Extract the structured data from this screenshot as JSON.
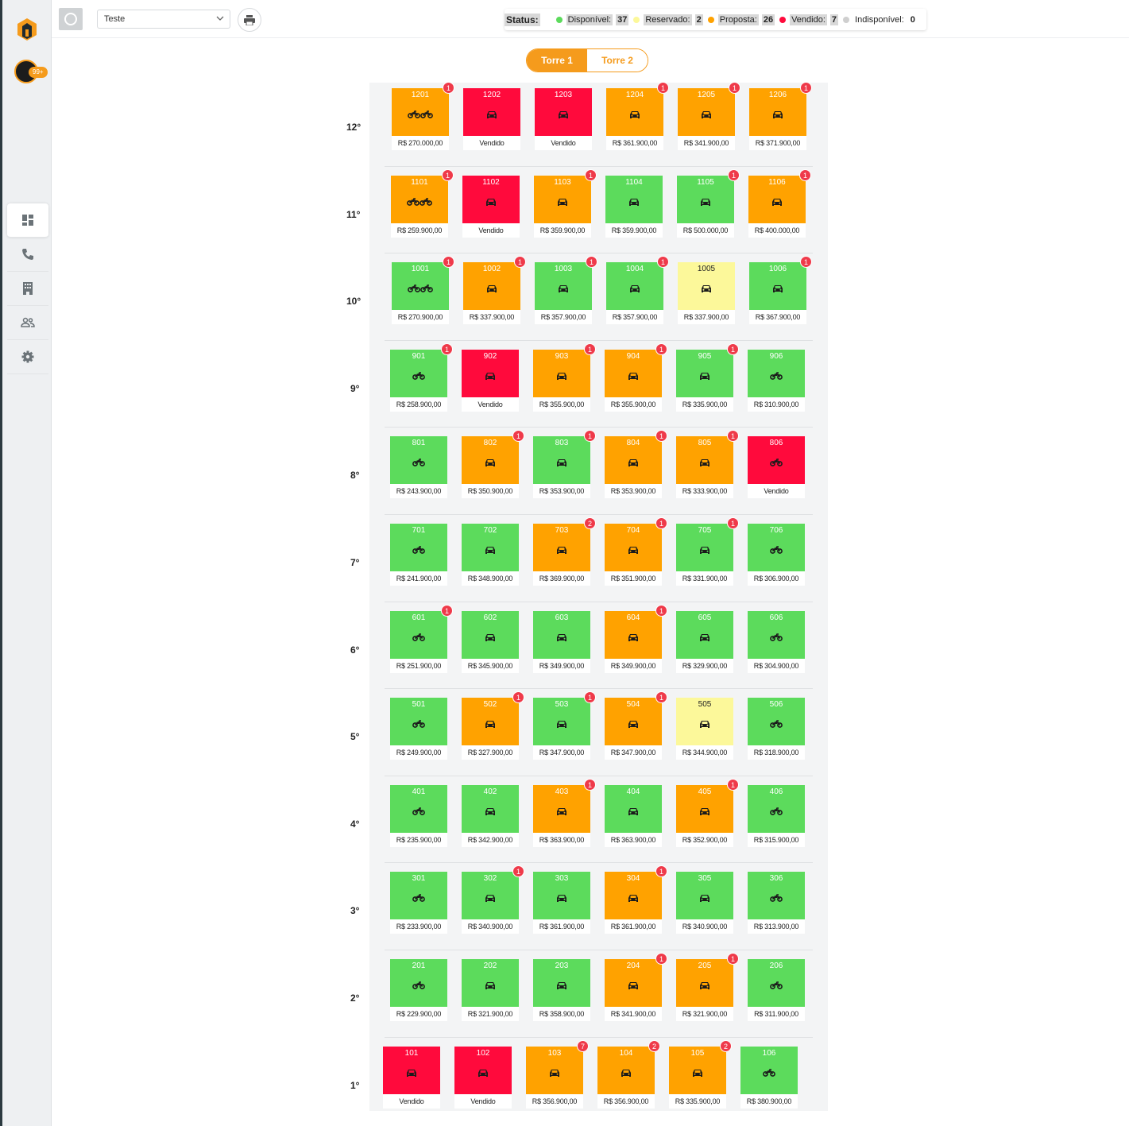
{
  "colors": {
    "disponivel": "#5cdb5c",
    "reservado": "#fcf89a",
    "proposta": "#ffa200",
    "vendido": "#ff0a3c",
    "indisponivel": "#cfcfcf",
    "accent": "#f59b1c"
  },
  "sidebar": {
    "notif_count": "99+",
    "nav": [
      {
        "icon": "dashboard-icon",
        "active": true
      },
      {
        "icon": "phone-icon",
        "active": false
      },
      {
        "icon": "building-icon",
        "active": false
      },
      {
        "icon": "people-icon",
        "active": false
      },
      {
        "icon": "gear-icon",
        "active": false
      }
    ]
  },
  "header": {
    "select_value": "Teste",
    "status_title": "Status:",
    "status": [
      {
        "label": "Disponível:",
        "count": "37",
        "color": "#5cdb5c"
      },
      {
        "label": "Reservado:",
        "count": "2",
        "color": "#fcf89a"
      },
      {
        "label": "Proposta:",
        "count": "26",
        "color": "#ffa200"
      },
      {
        "label": "Vendido:",
        "count": "7",
        "color": "#ff0a3c"
      },
      {
        "label": "Indisponível:",
        "count": "0",
        "color": "#cfcfcf"
      }
    ]
  },
  "tabs": [
    {
      "label": "Torre 1",
      "active": true
    },
    {
      "label": "Torre 2",
      "active": false
    }
  ],
  "floors": [
    {
      "label": "12°",
      "units": [
        {
          "num": "1201",
          "status": "proposta",
          "price": "R$ 270.000,00",
          "badge": "1",
          "vehicle": "moto2"
        },
        {
          "num": "1202",
          "status": "vendido",
          "price": "Vendido",
          "badge": "",
          "vehicle": "car"
        },
        {
          "num": "1203",
          "status": "vendido",
          "price": "Vendido",
          "badge": "",
          "vehicle": "car"
        },
        {
          "num": "1204",
          "status": "proposta",
          "price": "R$ 361.900,00",
          "badge": "1",
          "vehicle": "car"
        },
        {
          "num": "1205",
          "status": "proposta",
          "price": "R$ 341.900,00",
          "badge": "1",
          "vehicle": "car"
        },
        {
          "num": "1206",
          "status": "proposta",
          "price": "R$ 371.900,00",
          "badge": "1",
          "vehicle": "car"
        }
      ]
    },
    {
      "label": "11°",
      "units": [
        {
          "num": "1101",
          "status": "proposta",
          "price": "R$ 259.900,00",
          "badge": "1",
          "vehicle": "moto2"
        },
        {
          "num": "1102",
          "status": "vendido",
          "price": "Vendido",
          "badge": "",
          "vehicle": "car"
        },
        {
          "num": "1103",
          "status": "proposta",
          "price": "R$ 359.900,00",
          "badge": "1",
          "vehicle": "car"
        },
        {
          "num": "1104",
          "status": "disponivel",
          "price": "R$ 359.900,00",
          "badge": "",
          "vehicle": "car"
        },
        {
          "num": "1105",
          "status": "disponivel",
          "price": "R$ 500.000,00",
          "badge": "1",
          "vehicle": "car"
        },
        {
          "num": "1106",
          "status": "proposta",
          "price": "R$ 400.000,00",
          "badge": "1",
          "vehicle": "car"
        }
      ]
    },
    {
      "label": "10°",
      "units": [
        {
          "num": "1001",
          "status": "disponivel",
          "price": "R$ 270.900,00",
          "badge": "1",
          "vehicle": "moto2"
        },
        {
          "num": "1002",
          "status": "proposta",
          "price": "R$ 337.900,00",
          "badge": "1",
          "vehicle": "car"
        },
        {
          "num": "1003",
          "status": "disponivel",
          "price": "R$ 357.900,00",
          "badge": "1",
          "vehicle": "car"
        },
        {
          "num": "1004",
          "status": "disponivel",
          "price": "R$ 357.900,00",
          "badge": "1",
          "vehicle": "car"
        },
        {
          "num": "1005",
          "status": "reservado",
          "price": "R$ 337.900,00",
          "badge": "",
          "vehicle": "car"
        },
        {
          "num": "1006",
          "status": "disponivel",
          "price": "R$ 367.900,00",
          "badge": "1",
          "vehicle": "car"
        }
      ]
    },
    {
      "label": "9°",
      "units": [
        {
          "num": "901",
          "status": "disponivel",
          "price": "R$ 258.900,00",
          "badge": "1",
          "vehicle": "moto"
        },
        {
          "num": "902",
          "status": "vendido",
          "price": "Vendido",
          "badge": "",
          "vehicle": "car"
        },
        {
          "num": "903",
          "status": "proposta",
          "price": "R$ 355.900,00",
          "badge": "1",
          "vehicle": "car"
        },
        {
          "num": "904",
          "status": "proposta",
          "price": "R$ 355.900,00",
          "badge": "1",
          "vehicle": "car"
        },
        {
          "num": "905",
          "status": "disponivel",
          "price": "R$ 335.900,00",
          "badge": "1",
          "vehicle": "car"
        },
        {
          "num": "906",
          "status": "disponivel",
          "price": "R$ 310.900,00",
          "badge": "",
          "vehicle": "moto"
        }
      ]
    },
    {
      "label": "8°",
      "units": [
        {
          "num": "801",
          "status": "disponivel",
          "price": "R$ 243.900,00",
          "badge": "",
          "vehicle": "moto"
        },
        {
          "num": "802",
          "status": "proposta",
          "price": "R$ 350.900,00",
          "badge": "1",
          "vehicle": "car"
        },
        {
          "num": "803",
          "status": "disponivel",
          "price": "R$ 353.900,00",
          "badge": "1",
          "vehicle": "car"
        },
        {
          "num": "804",
          "status": "proposta",
          "price": "R$ 353.900,00",
          "badge": "1",
          "vehicle": "car"
        },
        {
          "num": "805",
          "status": "proposta",
          "price": "R$ 333.900,00",
          "badge": "1",
          "vehicle": "car"
        },
        {
          "num": "806",
          "status": "vendido",
          "price": "Vendido",
          "badge": "",
          "vehicle": "moto"
        }
      ]
    },
    {
      "label": "7°",
      "units": [
        {
          "num": "701",
          "status": "disponivel",
          "price": "R$ 241.900,00",
          "badge": "",
          "vehicle": "moto"
        },
        {
          "num": "702",
          "status": "disponivel",
          "price": "R$ 348.900,00",
          "badge": "",
          "vehicle": "car"
        },
        {
          "num": "703",
          "status": "proposta",
          "price": "R$ 369.900,00",
          "badge": "2",
          "vehicle": "car"
        },
        {
          "num": "704",
          "status": "proposta",
          "price": "R$ 351.900,00",
          "badge": "1",
          "vehicle": "car"
        },
        {
          "num": "705",
          "status": "disponivel",
          "price": "R$ 331.900,00",
          "badge": "1",
          "vehicle": "car"
        },
        {
          "num": "706",
          "status": "disponivel",
          "price": "R$ 306.900,00",
          "badge": "",
          "vehicle": "moto"
        }
      ]
    },
    {
      "label": "6°",
      "units": [
        {
          "num": "601",
          "status": "disponivel",
          "price": "R$ 251.900,00",
          "badge": "1",
          "vehicle": "moto"
        },
        {
          "num": "602",
          "status": "disponivel",
          "price": "R$ 345.900,00",
          "badge": "",
          "vehicle": "car"
        },
        {
          "num": "603",
          "status": "disponivel",
          "price": "R$ 349.900,00",
          "badge": "",
          "vehicle": "car"
        },
        {
          "num": "604",
          "status": "proposta",
          "price": "R$ 349.900,00",
          "badge": "1",
          "vehicle": "car"
        },
        {
          "num": "605",
          "status": "disponivel",
          "price": "R$ 329.900,00",
          "badge": "",
          "vehicle": "car"
        },
        {
          "num": "606",
          "status": "disponivel",
          "price": "R$ 304.900,00",
          "badge": "",
          "vehicle": "moto"
        }
      ]
    },
    {
      "label": "5°",
      "units": [
        {
          "num": "501",
          "status": "disponivel",
          "price": "R$ 249.900,00",
          "badge": "",
          "vehicle": "moto"
        },
        {
          "num": "502",
          "status": "proposta",
          "price": "R$ 327.900,00",
          "badge": "1",
          "vehicle": "car"
        },
        {
          "num": "503",
          "status": "disponivel",
          "price": "R$ 347.900,00",
          "badge": "1",
          "vehicle": "car"
        },
        {
          "num": "504",
          "status": "proposta",
          "price": "R$ 347.900,00",
          "badge": "1",
          "vehicle": "car"
        },
        {
          "num": "505",
          "status": "reservado",
          "price": "R$ 344.900,00",
          "badge": "",
          "vehicle": "car"
        },
        {
          "num": "506",
          "status": "disponivel",
          "price": "R$ 318.900,00",
          "badge": "",
          "vehicle": "moto"
        }
      ]
    },
    {
      "label": "4°",
      "units": [
        {
          "num": "401",
          "status": "disponivel",
          "price": "R$ 235.900,00",
          "badge": "",
          "vehicle": "moto"
        },
        {
          "num": "402",
          "status": "disponivel",
          "price": "R$ 342.900,00",
          "badge": "",
          "vehicle": "car"
        },
        {
          "num": "403",
          "status": "proposta",
          "price": "R$ 363.900,00",
          "badge": "1",
          "vehicle": "car"
        },
        {
          "num": "404",
          "status": "disponivel",
          "price": "R$ 363.900,00",
          "badge": "",
          "vehicle": "car"
        },
        {
          "num": "405",
          "status": "proposta",
          "price": "R$ 352.900,00",
          "badge": "1",
          "vehicle": "car"
        },
        {
          "num": "406",
          "status": "disponivel",
          "price": "R$ 315.900,00",
          "badge": "",
          "vehicle": "moto"
        }
      ]
    },
    {
      "label": "3°",
      "units": [
        {
          "num": "301",
          "status": "disponivel",
          "price": "R$ 233.900,00",
          "badge": "",
          "vehicle": "moto"
        },
        {
          "num": "302",
          "status": "disponivel",
          "price": "R$ 340.900,00",
          "badge": "1",
          "vehicle": "car"
        },
        {
          "num": "303",
          "status": "disponivel",
          "price": "R$ 361.900,00",
          "badge": "",
          "vehicle": "car"
        },
        {
          "num": "304",
          "status": "proposta",
          "price": "R$ 361.900,00",
          "badge": "1",
          "vehicle": "car"
        },
        {
          "num": "305",
          "status": "disponivel",
          "price": "R$ 340.900,00",
          "badge": "",
          "vehicle": "car"
        },
        {
          "num": "306",
          "status": "disponivel",
          "price": "R$ 313.900,00",
          "badge": "",
          "vehicle": "moto"
        }
      ]
    },
    {
      "label": "2°",
      "units": [
        {
          "num": "201",
          "status": "disponivel",
          "price": "R$ 229.900,00",
          "badge": "",
          "vehicle": "moto"
        },
        {
          "num": "202",
          "status": "disponivel",
          "price": "R$ 321.900,00",
          "badge": "",
          "vehicle": "car"
        },
        {
          "num": "203",
          "status": "disponivel",
          "price": "R$ 358.900,00",
          "badge": "",
          "vehicle": "car"
        },
        {
          "num": "204",
          "status": "proposta",
          "price": "R$ 341.900,00",
          "badge": "1",
          "vehicle": "car"
        },
        {
          "num": "205",
          "status": "proposta",
          "price": "R$ 321.900,00",
          "badge": "1",
          "vehicle": "car"
        },
        {
          "num": "206",
          "status": "disponivel",
          "price": "R$ 311.900,00",
          "badge": "",
          "vehicle": "moto"
        }
      ]
    },
    {
      "label": "1°",
      "units": [
        {
          "num": "101",
          "status": "vendido",
          "price": "Vendido",
          "badge": "",
          "vehicle": "car"
        },
        {
          "num": "102",
          "status": "vendido",
          "price": "Vendido",
          "badge": "",
          "vehicle": "car"
        },
        {
          "num": "103",
          "status": "proposta",
          "price": "R$ 356.900,00",
          "badge": "7",
          "vehicle": "car"
        },
        {
          "num": "104",
          "status": "proposta",
          "price": "R$ 356.900,00",
          "badge": "2",
          "vehicle": "car"
        },
        {
          "num": "105",
          "status": "proposta",
          "price": "R$ 335.900,00",
          "badge": "2",
          "vehicle": "car"
        },
        {
          "num": "106",
          "status": "disponivel",
          "price": "R$ 380.900,00",
          "badge": "",
          "vehicle": "moto"
        }
      ]
    }
  ]
}
